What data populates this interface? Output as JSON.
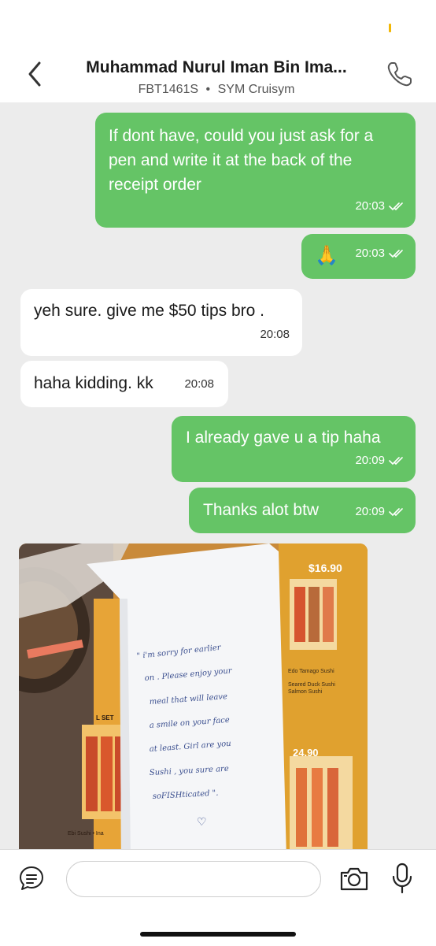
{
  "header": {
    "driver_name": "Muhammad Nurul Iman Bin Ima...",
    "plate": "FBT1461S",
    "separator": "•",
    "vehicle": "SYM Cruisym",
    "back_icon": "chevron-left-icon",
    "call_icon": "phone-icon"
  },
  "messages": [
    {
      "direction": "out",
      "text": "If dont have, could you just ask for a pen and write it at the back of the receipt order",
      "time": "20:03",
      "status": "read"
    },
    {
      "direction": "out",
      "text": "🙏",
      "time": "20:03",
      "status": "read"
    },
    {
      "direction": "in",
      "text": "yeh sure. give me $50 tips bro .",
      "time": "20:08"
    },
    {
      "direction": "in",
      "text": "haha kidding. kk",
      "time": "20:08"
    },
    {
      "direction": "out",
      "text": "I already gave u a tip haha",
      "time": "20:09",
      "status": "read"
    },
    {
      "direction": "out",
      "text": "Thanks alot btw",
      "time": "20:09",
      "status": "read"
    }
  ],
  "photo": {
    "menu_price_top": "$16.90",
    "menu_price_bottom": "24.90",
    "menu_items_right": [
      "Edo Tamago Sushi",
      "Seared Duck Sushi",
      "Salmon Sushi"
    ],
    "menu_left": [
      "L SET",
      "Ebi Sushi • Ina"
    ],
    "note_lines": [
      "\" i'm sorry for earlier",
      "on . Please enjoy your",
      "meal that will leave",
      "a smile on your face",
      "at least. Girl are you",
      "Sushi , you sure are",
      "soFISHticated \".",
      "♡"
    ]
  },
  "input_bar": {
    "placeholder": "",
    "chat_icon": "chat-bubble-icon",
    "camera_icon": "camera-icon",
    "mic_icon": "microphone-icon"
  },
  "colors": {
    "outgoing_bubble": "#65c466",
    "incoming_bubble": "#ffffff",
    "background": "#ececec"
  }
}
